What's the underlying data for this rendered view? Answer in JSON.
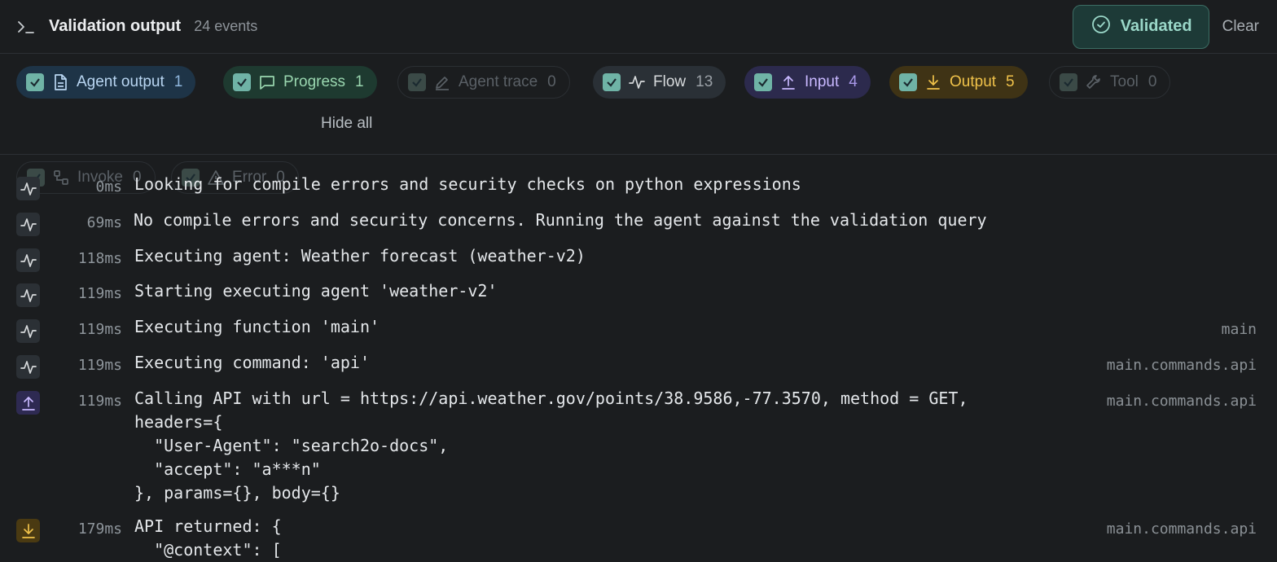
{
  "header": {
    "title": "Validation output",
    "count": "24 events",
    "status_label": "Validated",
    "clear_label": "Clear"
  },
  "filters": [
    {
      "label": "Agent output",
      "count": "1",
      "icon": "document-icon",
      "enabled": true
    },
    {
      "label": "Progress",
      "count": "1",
      "icon": "message-icon",
      "enabled": true
    },
    {
      "label": "Agent trace",
      "count": "0",
      "icon": "pencil-icon",
      "enabled": false
    },
    {
      "label": "Flow",
      "count": "13",
      "icon": "activity-icon",
      "enabled": true
    },
    {
      "label": "Input",
      "count": "4",
      "icon": "upload-icon",
      "enabled": true
    },
    {
      "label": "Output",
      "count": "5",
      "icon": "download-icon",
      "enabled": true
    },
    {
      "label": "Tool",
      "count": "0",
      "icon": "wrench-icon",
      "enabled": false
    },
    {
      "label": "Invoke",
      "count": "0",
      "icon": "workflow-icon",
      "enabled": false
    },
    {
      "label": "Error",
      "count": "0",
      "icon": "warning-icon",
      "enabled": false
    }
  ],
  "hide_all_label": "Hide all",
  "events": [
    {
      "type": "flow",
      "time": "0ms",
      "message": "Looking for compile errors and security checks on python expressions",
      "source": ""
    },
    {
      "type": "flow",
      "time": "69ms",
      "message": "No compile errors and security concerns. Running the agent against the validation query",
      "source": ""
    },
    {
      "type": "flow",
      "time": "118ms",
      "message": "Executing agent: Weather forecast (weather-v2)",
      "source": ""
    },
    {
      "type": "flow",
      "time": "119ms",
      "message": "Starting executing agent 'weather-v2'",
      "source": ""
    },
    {
      "type": "flow",
      "time": "119ms",
      "message": "Executing function 'main'",
      "source": "main"
    },
    {
      "type": "flow",
      "time": "119ms",
      "message": "Executing command: 'api'",
      "source": "main.commands.api"
    },
    {
      "type": "input",
      "time": "119ms",
      "message": "Calling API with url = https://api.weather.gov/points/38.9586,-77.3570, method = GET,\nheaders={\n  \"User-Agent\": \"search2o-docs\",\n  \"accept\": \"a***n\"\n}, params={}, body={}",
      "source": "main.commands.api"
    },
    {
      "type": "output",
      "time": "179ms",
      "message": "API returned: {\n  \"@context\": [",
      "source": "main.commands.api"
    }
  ],
  "colors": {
    "agent_output": "#b9d6f2",
    "progress": "#9ad7b0",
    "flow": "#d7dadc",
    "input": "#c8b8ff",
    "output": "#f0c24a"
  }
}
